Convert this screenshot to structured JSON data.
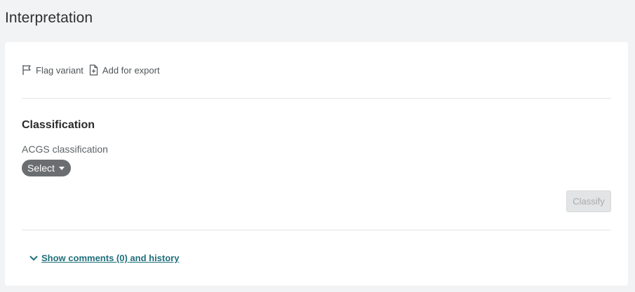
{
  "page": {
    "title": "Interpretation"
  },
  "actions": {
    "flag_label": "Flag variant",
    "export_label": "Add for export"
  },
  "classification": {
    "section_title": "Classification",
    "field_label": "ACGS classification",
    "select_value": "Select",
    "classify_label": "Classify",
    "classify_enabled": false
  },
  "comments": {
    "link_label": "Show comments (0) and history"
  },
  "colors": {
    "background": "#f2f3f4",
    "card": "#ffffff",
    "select_pill": "#6b6e70",
    "link": "#1f6f7a",
    "button_disabled_bg": "#e3e4e5",
    "button_disabled_text": "#a8abad"
  },
  "icons": {
    "flag": "flag-icon",
    "export": "file-plus-icon",
    "expand": "chevron-down-icon",
    "dropdown": "caret-down-icon"
  }
}
